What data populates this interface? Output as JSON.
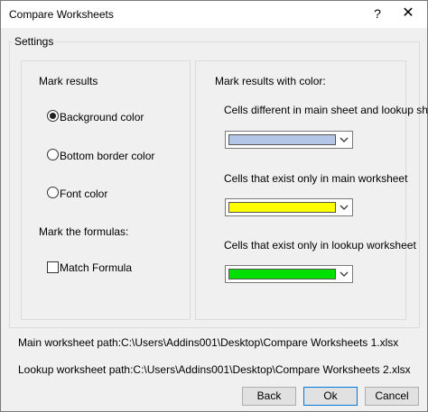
{
  "window": {
    "title": "Compare Worksheets",
    "help_label": "?",
    "close_label": "✕"
  },
  "settings": {
    "legend": "Settings",
    "mark_results_heading": "Mark results",
    "options": [
      {
        "label": "Background color",
        "checked": true
      },
      {
        "label": "Bottom border color",
        "checked": false
      },
      {
        "label": "Font color",
        "checked": false
      }
    ],
    "mark_formulas_heading": "Mark the formulas:",
    "match_formula_label": "Match Formula",
    "match_formula_checked": false
  },
  "colors": {
    "heading": "Mark results with color:",
    "items": [
      {
        "label": "Cells different in main sheet and lookup sheet",
        "color": "#b4c6e7"
      },
      {
        "label": "Cells that exist only in main worksheet",
        "color": "#ffff00"
      },
      {
        "label": "Cells that exist only in lookup worksheet",
        "color": "#00e000"
      }
    ]
  },
  "paths": {
    "main": "Main worksheet path:C:\\Users\\Addins001\\Desktop\\Compare Worksheets 1.xlsx",
    "lookup": "Lookup worksheet path:C:\\Users\\Addins001\\Desktop\\Compare Worksheets 2.xlsx"
  },
  "buttons": {
    "back": "Back",
    "ok": "Ok",
    "cancel": "Cancel"
  }
}
